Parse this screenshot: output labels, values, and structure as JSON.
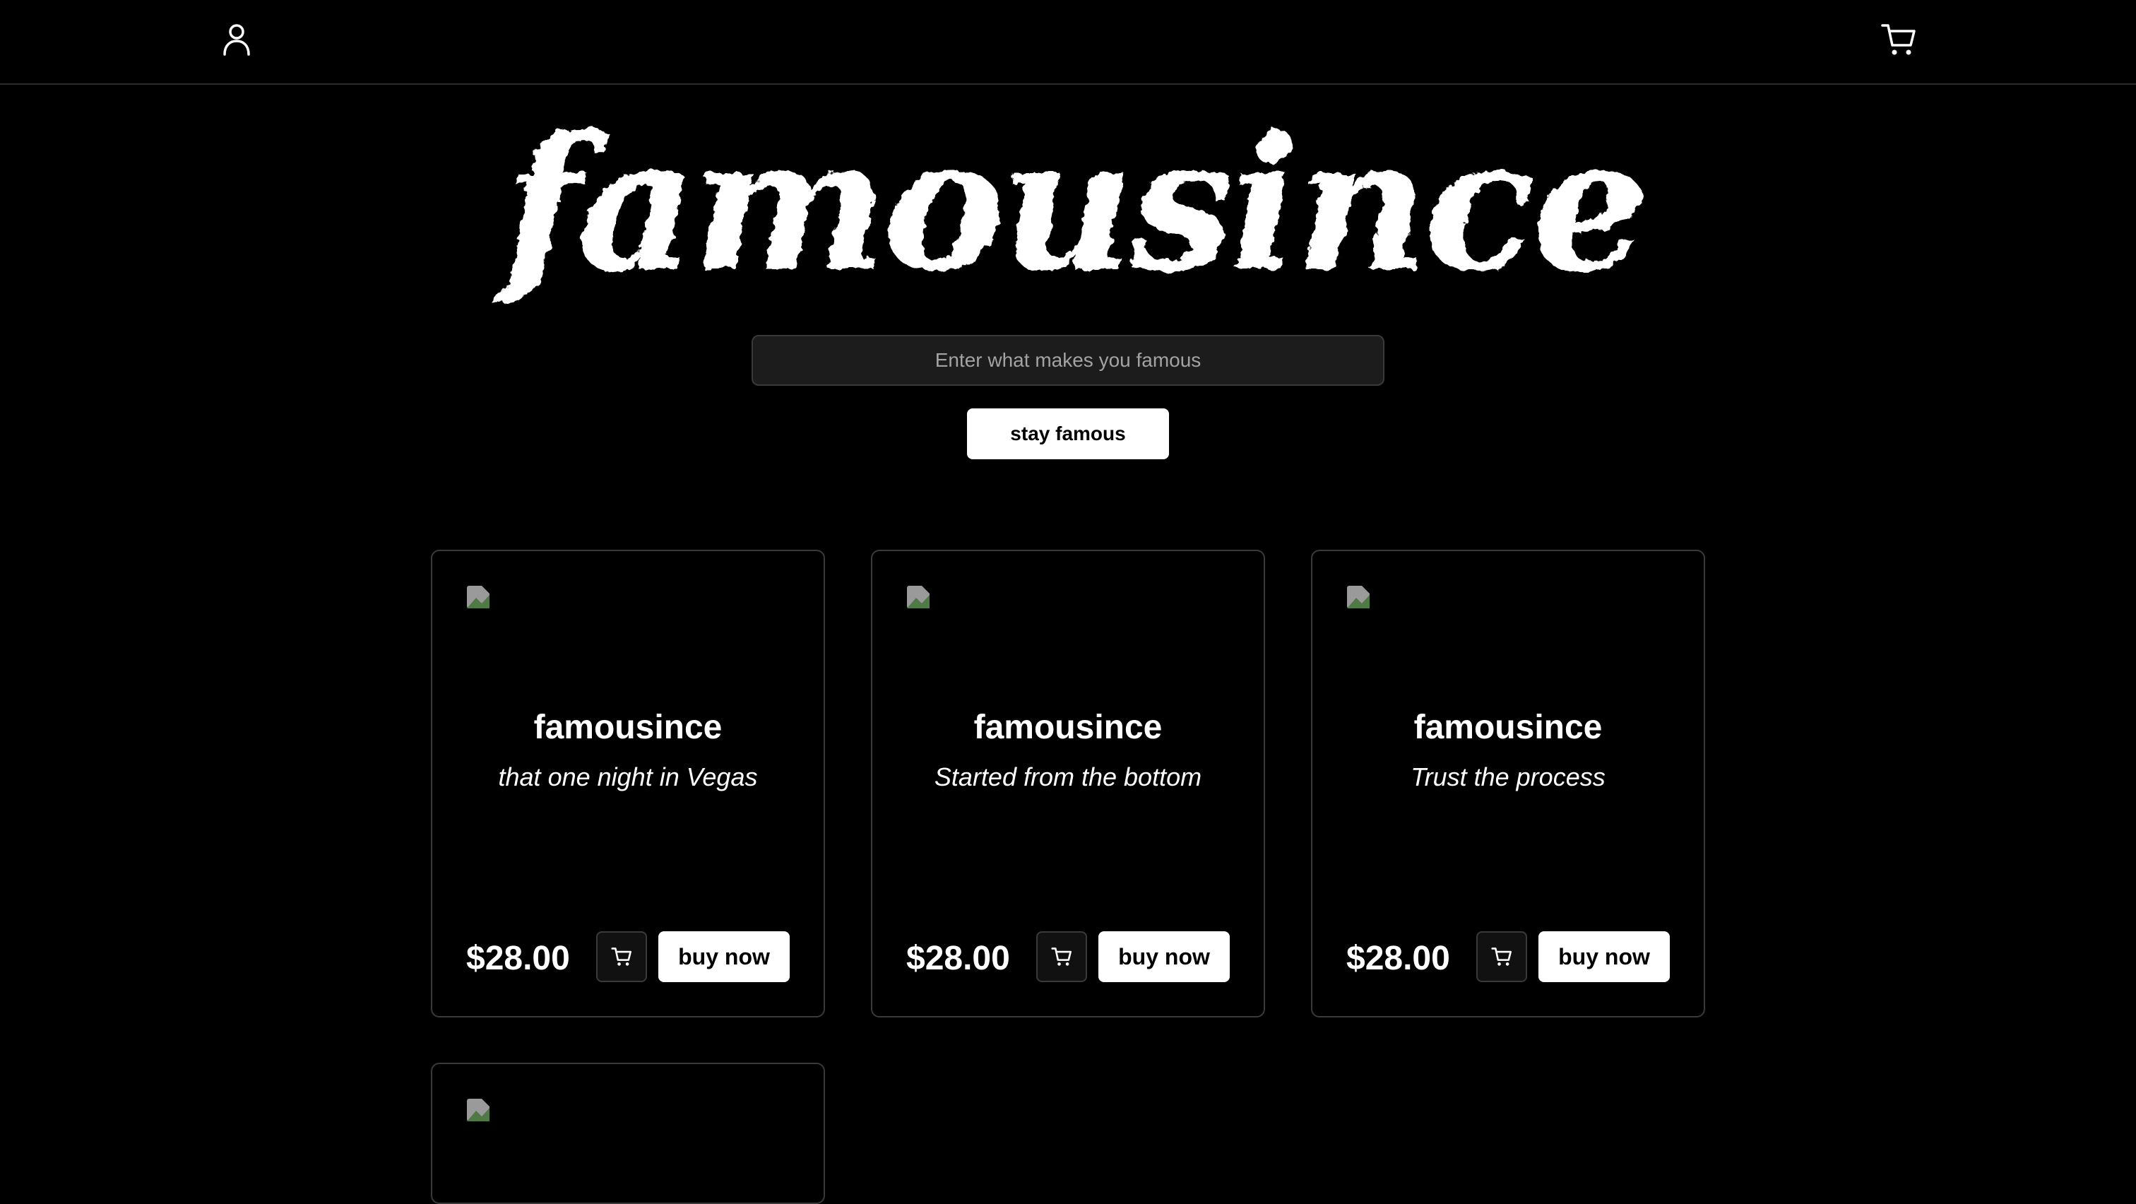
{
  "brand": {
    "logo_text": "famousince"
  },
  "header": {
    "user_icon": "user-icon",
    "cart_icon": "cart-icon"
  },
  "hero": {
    "search_placeholder": "Enter what makes you famous",
    "cta_label": "stay famous"
  },
  "products": [
    {
      "title": "famousince",
      "subtitle": "that one night in Vegas",
      "price": "$28.00",
      "buy_label": "buy now"
    },
    {
      "title": "famousince",
      "subtitle": "Started from the bottom",
      "price": "$28.00",
      "buy_label": "buy now"
    },
    {
      "title": "famousince",
      "subtitle": "Trust the process",
      "price": "$28.00",
      "buy_label": "buy now"
    }
  ],
  "colors": {
    "background": "#000000",
    "foreground": "#ffffff",
    "border": "#3a3a3a",
    "input_bg": "#1c1c1c"
  }
}
